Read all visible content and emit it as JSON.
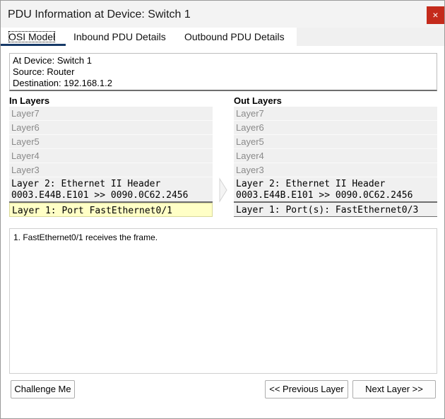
{
  "window": {
    "title": "PDU Information at Device: Switch 1",
    "close_label": "×"
  },
  "tabs": [
    {
      "label": "OSI Model",
      "active": true
    },
    {
      "label": "Inbound PDU Details",
      "active": false
    },
    {
      "label": "Outbound PDU Details",
      "active": false
    }
  ],
  "info": {
    "device": "At Device: Switch 1",
    "source": "Source: Router",
    "destination": "Destination: 192.168.1.2"
  },
  "in_layers": {
    "heading": "In Layers",
    "upper": [
      "Layer7",
      "Layer6",
      "Layer5",
      "Layer4",
      "Layer3"
    ],
    "layer2_line1": "Layer 2: Ethernet II Header",
    "layer2_line2": "0003.E44B.E101 >> 0090.0C62.2456",
    "layer1": "Layer 1: Port FastEthernet0/1"
  },
  "out_layers": {
    "heading": "Out Layers",
    "upper": [
      "Layer7",
      "Layer6",
      "Layer5",
      "Layer4",
      "Layer3"
    ],
    "layer2_line1": "Layer 2: Ethernet II Header",
    "layer2_line2": "0003.E44B.E101 >> 0090.0C62.2456",
    "layer1": "Layer 1: Port(s): FastEthernet0/3"
  },
  "description": "1. FastEthernet0/1 receives the frame.",
  "buttons": {
    "challenge": "Challenge Me",
    "previous": "<< Previous Layer",
    "next": "Next Layer >>"
  },
  "colors": {
    "close_bg": "#c42b1c",
    "active_tab_underline": "#163a68",
    "selected_layer_bg": "#ffffc6"
  }
}
